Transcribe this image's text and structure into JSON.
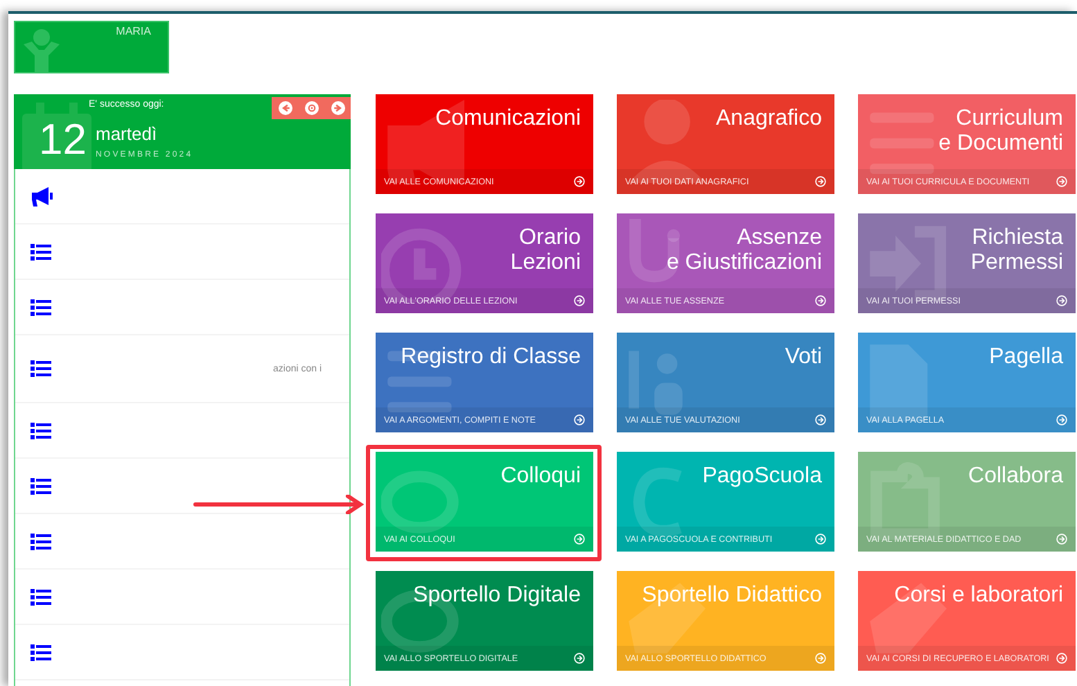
{
  "user": {
    "name": "MARIA"
  },
  "today": {
    "caption": "E' successo oggi:",
    "day": "12",
    "weekday": "martedì",
    "month_year": "NOVEMBRE 2024"
  },
  "sidebar": {
    "items": [
      {
        "kind": "megaphone"
      },
      {
        "kind": "list"
      },
      {
        "kind": "list"
      },
      {
        "kind": "list",
        "text": "azioni con i"
      },
      {
        "kind": "list"
      },
      {
        "kind": "list"
      },
      {
        "kind": "list"
      },
      {
        "kind": "list"
      },
      {
        "kind": "list"
      }
    ]
  },
  "tiles": [
    {
      "title": "Comunicazioni",
      "link": "VAI ALLE COMUNICAZIONI",
      "color": "#ee0000",
      "kind": "megaphone",
      "highlighted": false
    },
    {
      "title": "Anagrafico",
      "link": "VAI AI TUOI DATI ANAGRAFICI",
      "color": "#e8392b",
      "kind": "person",
      "highlighted": false
    },
    {
      "title": "Curriculum\ne Documenti",
      "link": "VAI AI TUOI CURRICULA E DOCUMENTI",
      "color": "#f25f64",
      "kind": "lines",
      "highlighted": false
    },
    {
      "title": "Orario\nLezioni",
      "link": "VAI ALL'ORARIO DELLE LEZIONI",
      "color": "#973eb0",
      "kind": "clock",
      "highlighted": false
    },
    {
      "title": "Assenze\ne Giustificazioni",
      "link": "VAI ALLE TUE ASSENZE",
      "color": "#a957b8",
      "kind": "stethoscope",
      "highlighted": false
    },
    {
      "title": "Richiesta\nPermessi",
      "link": "VAI AI TUOI PERMESSI",
      "color": "#8a74aa",
      "kind": "exit",
      "highlighted": false
    },
    {
      "title": "Registro di Classe",
      "link": "VAI A ARGOMENTI, COMPITI E NOTE",
      "color": "#3d72c0",
      "kind": "lines",
      "highlighted": false
    },
    {
      "title": "Voti",
      "link": "VAI ALLE TUE VALUTAZIONI",
      "color": "#3786c0",
      "kind": "grade",
      "highlighted": false
    },
    {
      "title": "Pagella",
      "link": "VAI ALLA PAGELLA",
      "color": "#3e99d6",
      "kind": "document",
      "highlighted": false
    },
    {
      "title": "Colloqui",
      "link": "VAI AI COLLOQUI",
      "color": "#00c676",
      "kind": "chat",
      "highlighted": true
    },
    {
      "title": "PagoScuola",
      "link": "VAI A PAGOSCUOLA E CONTRIBUTI",
      "color": "#00b5b0",
      "kind": "euro",
      "highlighted": false
    },
    {
      "title": "Collabora",
      "link": "VAI AL MATERIALE DIDATTICO E DAD",
      "color": "#86bc89",
      "kind": "puzzle",
      "highlighted": false
    },
    {
      "title": "Sportello Digitale",
      "link": "VAI ALLO SPORTELLO DIGITALE",
      "color": "#008c50",
      "kind": "chat",
      "highlighted": false
    },
    {
      "title": "Sportello Didattico",
      "link": "VAI ALLO SPORTELLO DIDATTICO",
      "color": "#ffb322",
      "kind": "hand",
      "highlighted": false
    },
    {
      "title": "Corsi e laboratori",
      "link": "VAI AI CORSI DI RECUPERO E LABORATORI",
      "color": "#ff5c52",
      "kind": "hand",
      "highlighted": false
    }
  ]
}
